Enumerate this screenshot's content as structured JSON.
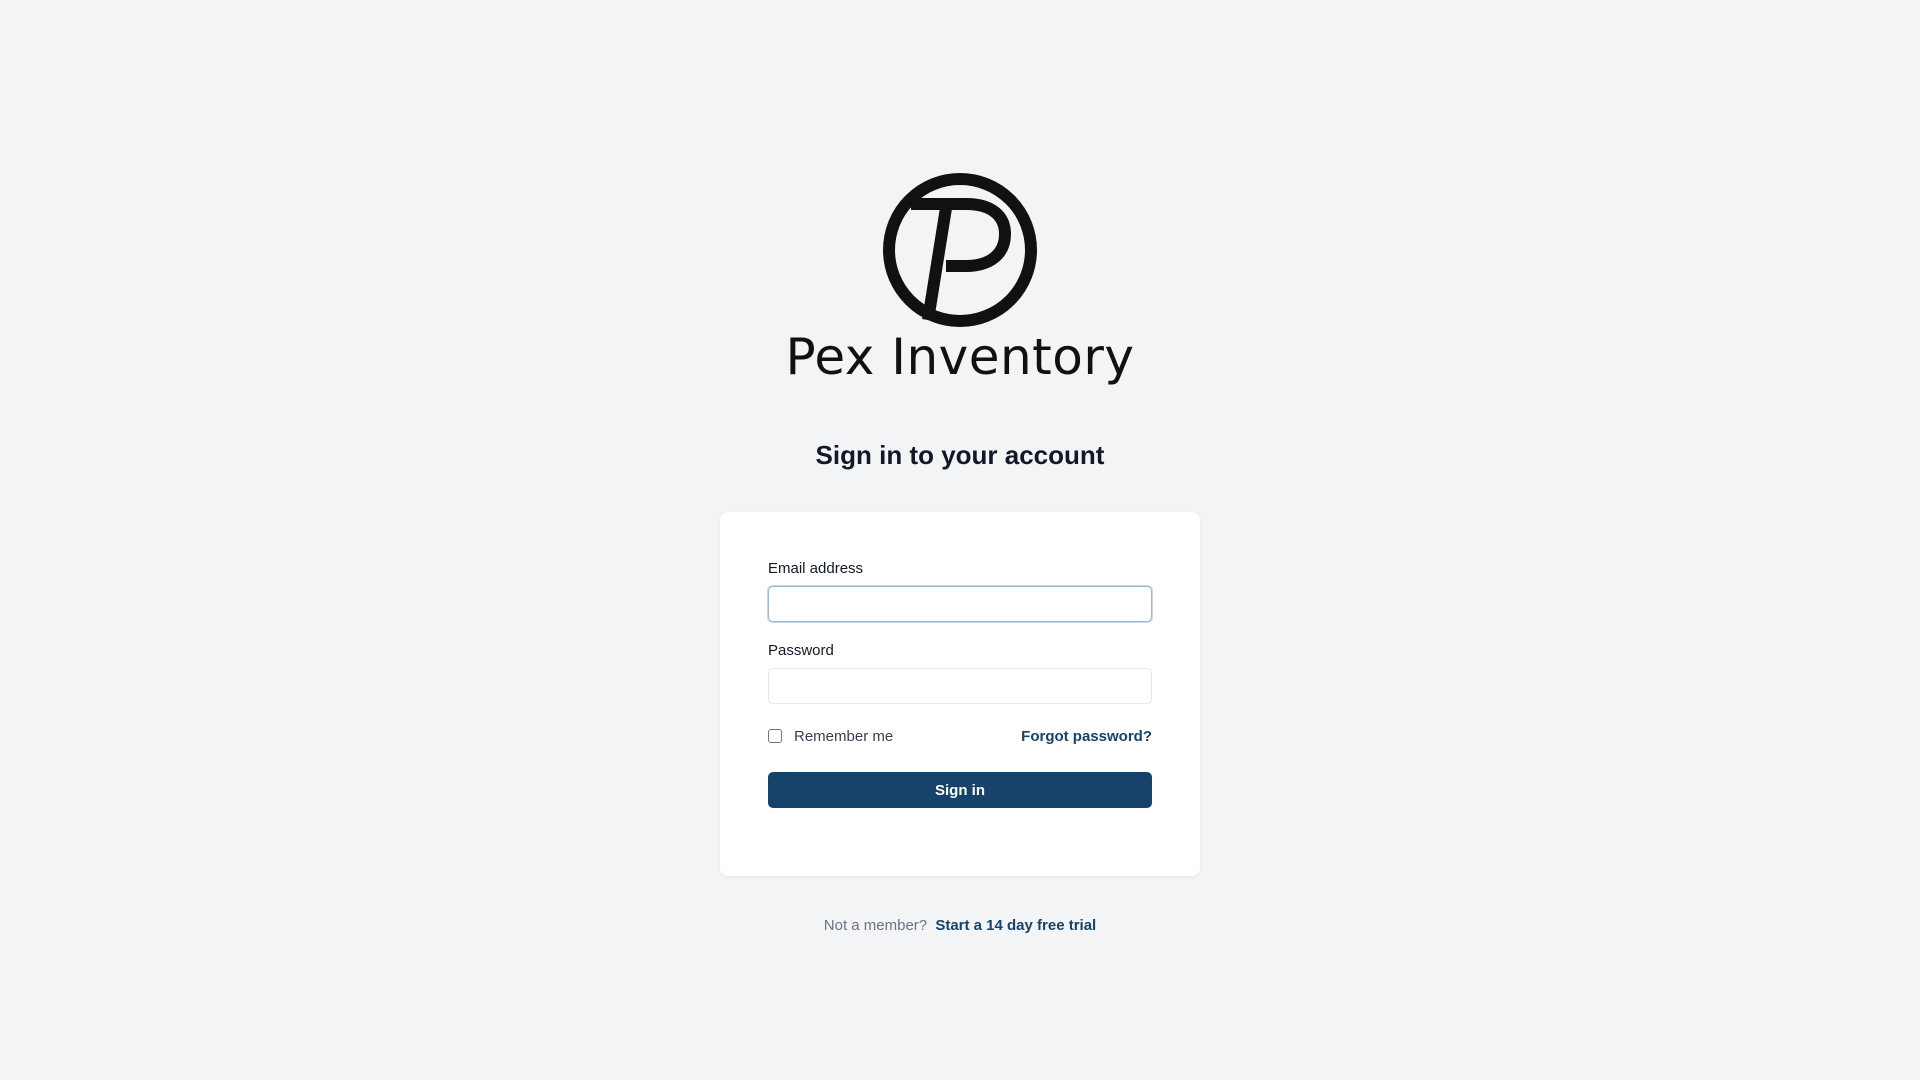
{
  "brand": {
    "name": "Pex Inventory",
    "logo_icon": "pex-circle-p-logo"
  },
  "heading": "Sign in to your account",
  "form": {
    "email_label": "Email address",
    "email_value": "",
    "email_placeholder": "",
    "password_label": "Password",
    "password_value": "",
    "password_placeholder": "",
    "remember_label": "Remember me",
    "remember_checked": false,
    "forgot_label": "Forgot password?",
    "submit_label": "Sign in"
  },
  "footer": {
    "prompt": "Not a member?",
    "trial_link": "Start a 14 day free trial"
  },
  "colors": {
    "background": "#f3f4f6",
    "accent": "#17436b",
    "card": "#ffffff"
  }
}
